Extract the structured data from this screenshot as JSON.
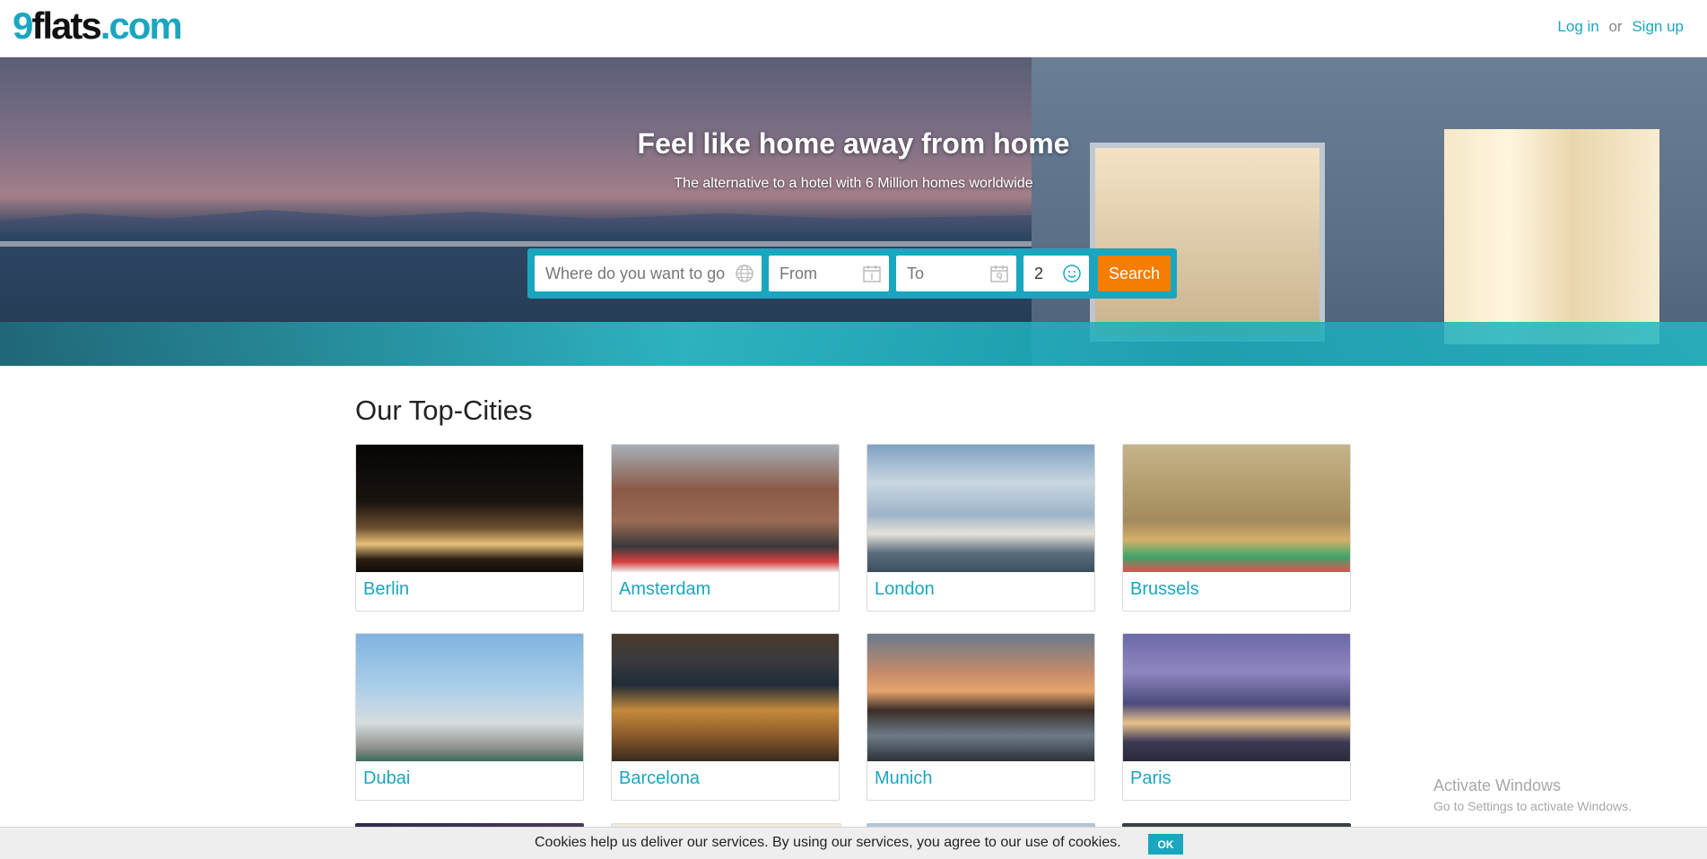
{
  "header": {
    "logo": {
      "nine": "9",
      "flats": "flats",
      "com": ".com"
    },
    "login": "Log in",
    "or": "or",
    "signup": "Sign up"
  },
  "hero": {
    "title": "Feel like home away from home",
    "subtitle": "The alternative to a hotel with 6 Million homes worldwide"
  },
  "search": {
    "where_placeholder": "Where do you want to go",
    "from_placeholder": "From",
    "to_placeholder": "To",
    "guests": "2",
    "button": "Search",
    "icons": {
      "where": "globe-icon",
      "from": "calendar-icon",
      "to": "calendar-icon",
      "guests": "smiley-icon"
    },
    "colors": {
      "bar": "#1aa6bf",
      "button": "#f57d00"
    }
  },
  "top_cities": {
    "title": "Our Top-Cities",
    "cities": [
      {
        "name": "Berlin"
      },
      {
        "name": "Amsterdam"
      },
      {
        "name": "London"
      },
      {
        "name": "Brussels"
      },
      {
        "name": "Dubai"
      },
      {
        "name": "Barcelona"
      },
      {
        "name": "Munich"
      },
      {
        "name": "Paris"
      }
    ]
  },
  "cookie": {
    "text": "Cookies help us deliver our services. By using our services, you agree to our use of cookies.",
    "ok": "OK"
  },
  "watermark": {
    "line1": "Activate Windows",
    "line2": "Go to Settings to activate Windows."
  },
  "colors": {
    "accent": "#1aa6bf",
    "cta": "#f57d00"
  }
}
